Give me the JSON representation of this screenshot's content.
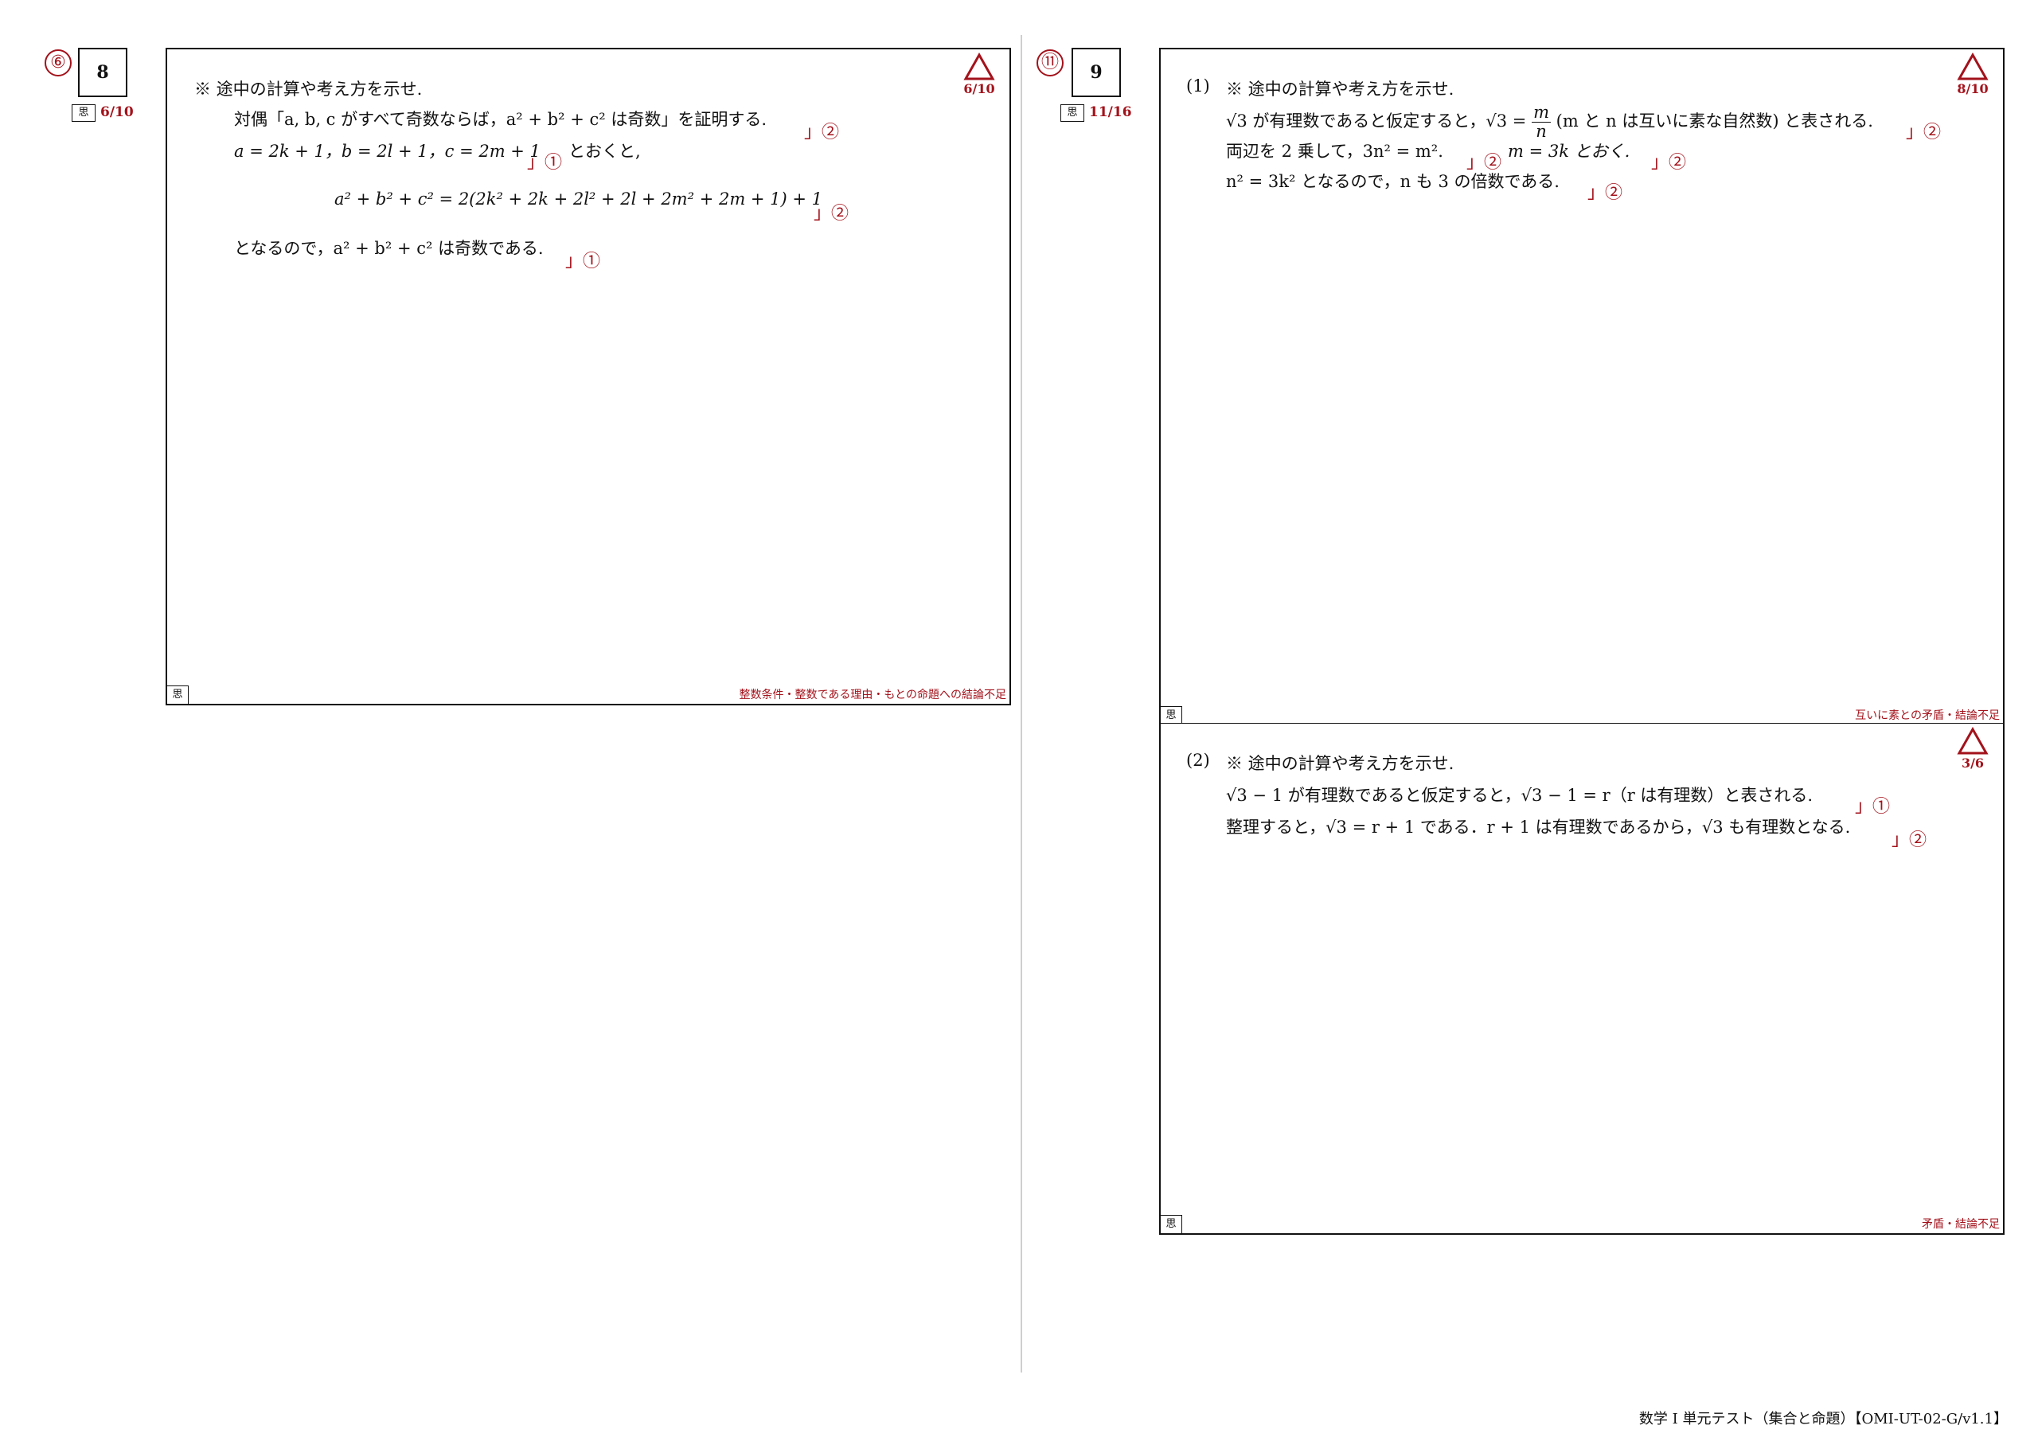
{
  "left": {
    "circle_number": "⑥",
    "question_number": "8",
    "tag": "思",
    "score": "6/10",
    "grade_score": "6/10",
    "box_tag": "思",
    "lines": [
      "※ 途中の計算や考え方を示せ.",
      "対偶「a, b, c がすべて奇数ならば，a² + b² + c² は奇数」を証明する.",
      "a = 2k + 1，b = 2l + 1，c = 2m + 1",
      "とおくと,",
      "a² + b² + c² = 2(2k² + 2k + 2l² + 2l + 2m² + 2m + 1) + 1",
      "となるので，a² + b² + c² は奇数である."
    ],
    "marks": [
      "」②",
      "」①",
      "」②",
      "」①"
    ],
    "comment": "整数条件・整数である理由・もとの命題への結論不足"
  },
  "right": {
    "circle_number": "⑪",
    "question_number": "9",
    "tag": "思",
    "score": "11/16",
    "part1": {
      "label": "(1)",
      "grade_score": "8/10",
      "box_tag": "思",
      "lines": [
        "※ 途中の計算や考え方を示せ.",
        "√3 が有理数であると仮定すると，√3 = ",
        "m",
        "n",
        "(m と n は互いに素な自然数) と表される.",
        "両辺を 2 乗して，3n² = m².",
        "m = 3k とおく.",
        "n² = 3k² となるので，n も 3 の倍数である."
      ],
      "marks": [
        "」②",
        "」②",
        "」②",
        "」②"
      ],
      "comment": "互いに素との矛盾・結論不足"
    },
    "part2": {
      "label": "(2)",
      "grade_score": "3/6",
      "box_tag": "思",
      "lines": [
        "※ 途中の計算や考え方を示せ.",
        "√3 − 1 が有理数であると仮定すると，√3 − 1 = r（r は有理数）と表される.",
        "整理すると，√3 = r + 1 である．r + 1 は有理数であるから，√3 も有理数となる."
      ],
      "marks": [
        "」①",
        "」②"
      ],
      "comment": "矛盾・結論不足"
    }
  },
  "footer": "数学 I 単元テスト（集合と命題）【OMI-UT-02-G/v1.1】",
  "colors": {
    "red": "#a3121b",
    "ink": "#111111",
    "divider": "#cfcfcf"
  },
  "icons": {
    "grade": "triangle-icon"
  }
}
